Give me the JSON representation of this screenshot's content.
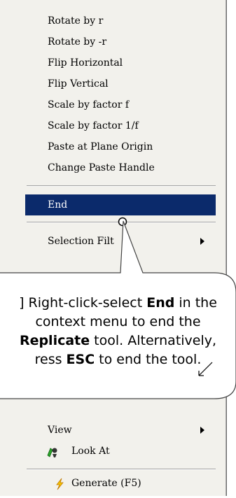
{
  "menu": {
    "items_top": [
      {
        "label": "Rotate by r"
      },
      {
        "label": "Rotate by -r"
      },
      {
        "label": "Flip Horizontal"
      },
      {
        "label": "Flip Vertical"
      },
      {
        "label": "Scale by factor f"
      },
      {
        "label": "Scale by factor 1/f"
      },
      {
        "label": "Paste at Plane Origin"
      },
      {
        "label": "Change Paste Handle"
      }
    ],
    "end_label": "End",
    "selection_filter_label": "Selection Filt",
    "view_label": "View",
    "look_at_label": "Look At",
    "generate_label": "Generate (F5)",
    "selected_color": "#0b2a6b"
  },
  "callout": {
    "line1_pre": "] Right-click-select ",
    "line1_bold": "End",
    "line1_post": " in the",
    "line2": "context menu to end the",
    "line3_bold": "Replicate",
    "line3_post": " tool. Alternatively,",
    "line4_pre": "ress ",
    "line4_bold": "ESC",
    "line4_post": " to end the tool."
  },
  "icons": {
    "look_at": "look-at-icon",
    "generate": "lightning-icon",
    "cursor": "mouse-pointer-icon",
    "submenu": "submenu-arrow-icon"
  }
}
